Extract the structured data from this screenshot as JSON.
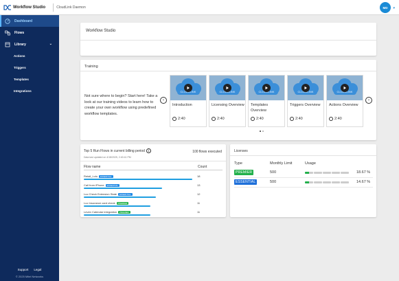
{
  "app": {
    "title": "Workflow Studio",
    "tenant": "CloudLink Daemon",
    "avatar_initials": "MD"
  },
  "sidebar": {
    "items": [
      {
        "label": "Dashboard",
        "icon": "dashboard-icon",
        "active": true
      },
      {
        "label": "Flows",
        "icon": "flows-icon",
        "active": false
      },
      {
        "label": "Library",
        "icon": "library-icon",
        "active": false
      }
    ],
    "library_sub": [
      "Actions",
      "Triggers",
      "Templates",
      "Integrations"
    ],
    "footer_links": [
      "Support",
      "Legal"
    ],
    "copyright": "© 2025 Mitel Networks"
  },
  "workflow_card": {
    "title": "Workflow Studio"
  },
  "training": {
    "title": "Training",
    "intro": "Not sure where to begin? Start here! Take a look at our training videos to learn how to create your own workflow using predefined workflow templates.",
    "thumb_text": "CLOUDLINK",
    "videos": [
      {
        "title": "Introduction",
        "duration": "2:40"
      },
      {
        "title": "Licensing Overview",
        "duration": "2:40"
      },
      {
        "title": "Templates Overview",
        "duration": "2:40"
      },
      {
        "title": "Triggers Overview",
        "duration": "2:40"
      },
      {
        "title": "Actions Overview",
        "duration": "2:40"
      }
    ]
  },
  "top_flows": {
    "title": "Top 5 Run Flows in current billing period",
    "executed": "100 flows executed",
    "updated": "Data last updated on 4/18/2025, 2:40:41 PM",
    "col_name": "Flow name",
    "col_count": "Count",
    "rows": [
      {
        "name": "Retail_Lulu",
        "badge": "ESSENTIAL",
        "badge_color": "#1e88e5",
        "count": "18"
      },
      {
        "name": "Call from iPhone",
        "badge": "ESSENTIAL",
        "badge_color": "#1e88e5",
        "count": "13"
      },
      {
        "name": "Luc Check Extension State",
        "badge": "ESSENTIAL",
        "badge_color": "#1e88e5",
        "count": "12"
      },
      {
        "name": "Luc Insurance card check",
        "badge": "PREMIER",
        "badge_color": "#22b04b",
        "count": "11"
      },
      {
        "name": "Leven Calendar integration",
        "badge": "PREMIER",
        "badge_color": "#22b04b",
        "count": "11"
      }
    ],
    "max_count": 18
  },
  "licenses": {
    "title": "Licenses",
    "col_type": "Type",
    "col_limit": "Monthly Limit",
    "col_usage": "Usage",
    "rows": [
      {
        "type": "PREMIER",
        "color": "#22b04b",
        "limit": "500",
        "usage": "18.67 %",
        "usage_fraction": 0.1867
      },
      {
        "type": "ESSENTIAL",
        "color": "#1e6fd9",
        "limit": "500",
        "usage": "14.67 %",
        "usage_fraction": 0.1467
      }
    ]
  }
}
